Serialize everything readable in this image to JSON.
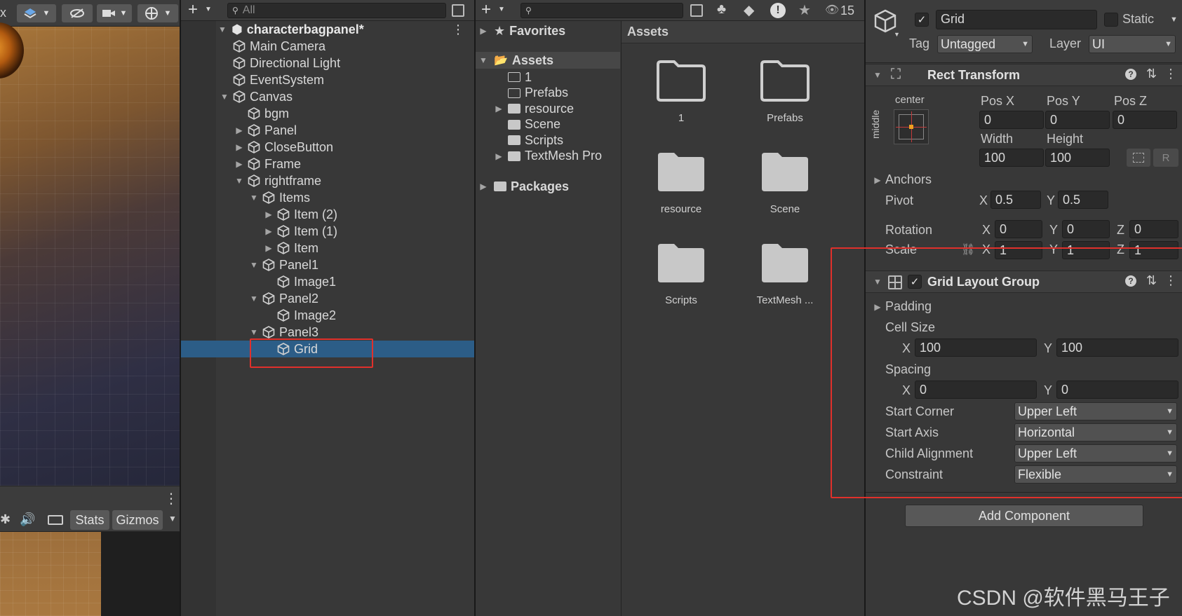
{
  "scene_toolbar": {
    "close_glyph": "x",
    "stats_label": "Stats",
    "gizmos_label": "Gizmos"
  },
  "hierarchy": {
    "search_placeholder": "All",
    "root": "characterbagpanel*",
    "items": [
      {
        "label": "Main Camera",
        "depth": 1,
        "arrow": ""
      },
      {
        "label": "Directional Light",
        "depth": 1,
        "arrow": ""
      },
      {
        "label": "EventSystem",
        "depth": 1,
        "arrow": ""
      },
      {
        "label": "Canvas",
        "depth": 1,
        "arrow": "down"
      },
      {
        "label": "bgm",
        "depth": 2,
        "arrow": ""
      },
      {
        "label": "Panel",
        "depth": 2,
        "arrow": "right"
      },
      {
        "label": "CloseButton",
        "depth": 2,
        "arrow": "right"
      },
      {
        "label": "Frame",
        "depth": 2,
        "arrow": "right"
      },
      {
        "label": "rightframe",
        "depth": 2,
        "arrow": "down"
      },
      {
        "label": "Items",
        "depth": 3,
        "arrow": "down"
      },
      {
        "label": "Item (2)",
        "depth": 4,
        "arrow": "right"
      },
      {
        "label": "Item (1)",
        "depth": 4,
        "arrow": "right"
      },
      {
        "label": "Item",
        "depth": 4,
        "arrow": "right"
      },
      {
        "label": "Panel1",
        "depth": 3,
        "arrow": "down"
      },
      {
        "label": "Image1",
        "depth": 4,
        "arrow": ""
      },
      {
        "label": "Panel2",
        "depth": 3,
        "arrow": "down"
      },
      {
        "label": "Image2",
        "depth": 4,
        "arrow": ""
      },
      {
        "label": "Panel3",
        "depth": 3,
        "arrow": "down"
      },
      {
        "label": "Grid",
        "depth": 4,
        "arrow": "",
        "selected": true
      }
    ]
  },
  "project": {
    "hidden_count": "15",
    "favorites": "Favorites",
    "assets": "Assets",
    "assets_header": "Assets",
    "asset_children": [
      {
        "label": "1",
        "arrow": "",
        "empty": true
      },
      {
        "label": "Prefabs",
        "arrow": "",
        "empty": true
      },
      {
        "label": "resource",
        "arrow": "right",
        "empty": false
      },
      {
        "label": "Scene",
        "arrow": "",
        "empty": false
      },
      {
        "label": "Scripts",
        "arrow": "",
        "empty": false
      },
      {
        "label": "TextMesh Pro",
        "arrow": "right",
        "empty": false
      }
    ],
    "packages": "Packages",
    "grid": [
      {
        "label": "1",
        "empty": true
      },
      {
        "label": "Prefabs",
        "empty": true
      },
      {
        "label": "resource",
        "empty": false
      },
      {
        "label": "Scene",
        "empty": false
      },
      {
        "label": "Scripts",
        "empty": false
      },
      {
        "label": "TextMesh ...",
        "empty": false
      }
    ]
  },
  "inspector": {
    "name": "Grid",
    "static_label": "Static",
    "tag_label": "Tag",
    "tag_value": "Untagged",
    "layer_label": "Layer",
    "layer_value": "UI",
    "rect": {
      "title": "Rect Transform",
      "anchor_h": "center",
      "anchor_v": "middle",
      "posx_label": "Pos X",
      "posy_label": "Pos Y",
      "posz_label": "Pos Z",
      "posx": "0",
      "posy": "0",
      "posz": "0",
      "width_label": "Width",
      "height_label": "Height",
      "width": "100",
      "height": "100",
      "r_button": "R",
      "anchors_label": "Anchors",
      "pivot_label": "Pivot",
      "pivot_x": "0.5",
      "pivot_y": "0.5",
      "rotation_label": "Rotation",
      "rot_x": "0",
      "rot_y": "0",
      "rot_z": "0",
      "scale_label": "Scale",
      "scale_x": "1",
      "scale_y": "1",
      "scale_z": "1",
      "x": "X",
      "y": "Y",
      "z": "Z"
    },
    "grid_layout": {
      "title": "Grid Layout Group",
      "padding_label": "Padding",
      "cell_size_label": "Cell Size",
      "cell_x": "100",
      "cell_y": "100",
      "spacing_label": "Spacing",
      "spacing_x": "0",
      "spacing_y": "0",
      "start_corner_label": "Start Corner",
      "start_corner": "Upper Left",
      "start_axis_label": "Start Axis",
      "start_axis": "Horizontal",
      "child_alignment_label": "Child Alignment",
      "child_alignment": "Upper Left",
      "constraint_label": "Constraint",
      "constraint": "Flexible"
    },
    "add_component": "Add Component"
  },
  "watermark": "CSDN @软件黑马王子",
  "colors": {
    "selection": "#2c5d87",
    "highlight_box": "#e0302b"
  }
}
